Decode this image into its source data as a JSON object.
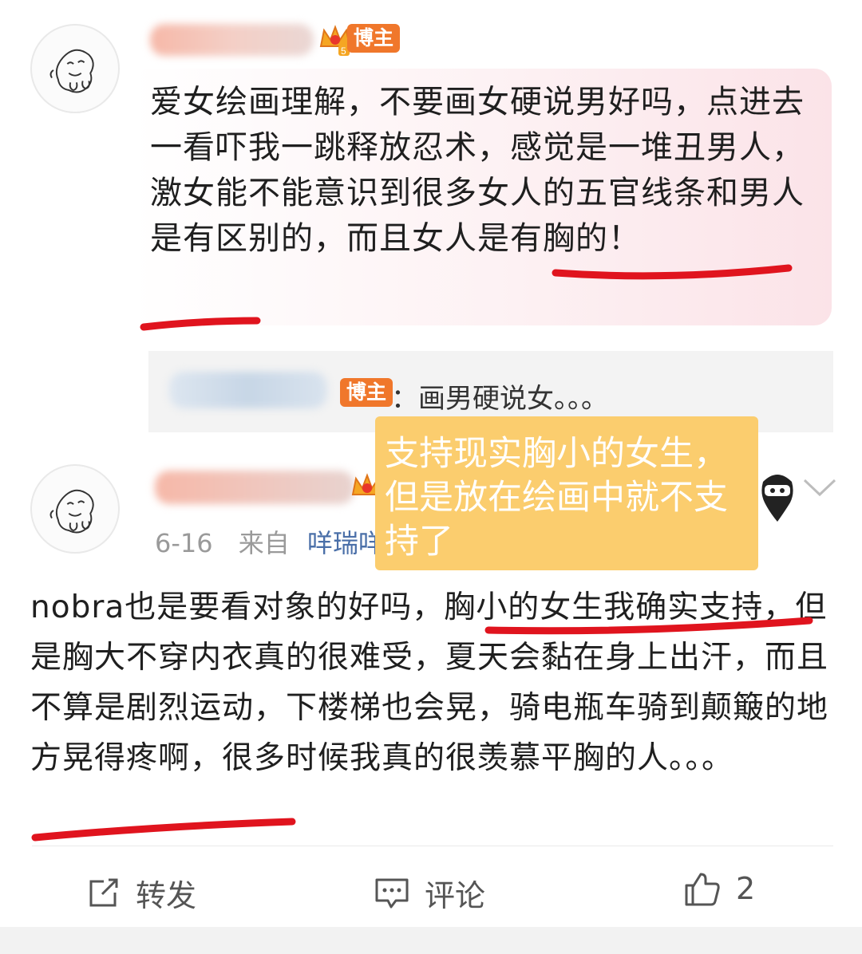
{
  "comment1": {
    "badge": "博主",
    "crown_level": "5",
    "text": "爱女绘画理解，不要画女硬说男好吗，点进去一看吓我一跳释放忍术，感觉是一堆丑男人，激女能不能意识到很多女人的五官线条和男人是有区别的，而且女人是有胸的！",
    "reply": {
      "badge": "博主",
      "text": "：画男硬说女。。。"
    }
  },
  "note": {
    "text": "支持现实胸小的女生，但是放在绘画中就不支持了"
  },
  "comment2": {
    "date": "6-16",
    "from_label": "来自",
    "source_link": "咩瑞咩",
    "text": "nobra也是要看对象的好吗，胸小的女生我确实支持，但是胸大不穿内衣真的很难受，夏天会黏在身上出汗，而且不算是剧烈运动，下楼梯也会晃，骑电瓶车骑到颠簸的地方晃得疼啊，很多时候我真的很羡慕平胸的人。。。"
  },
  "actions": {
    "forward_label": "转发",
    "comment_label": "评论",
    "like_count": "2"
  },
  "icons": {
    "forward": "share-square-icon",
    "comment": "comment-bubble-icon",
    "like": "thumbs-up-icon",
    "expand": "chevron-down-icon"
  },
  "colors": {
    "badge": "#f0772b",
    "note": "#fbcd6e",
    "underline": "#e0141e",
    "link": "#4a6fa8"
  }
}
